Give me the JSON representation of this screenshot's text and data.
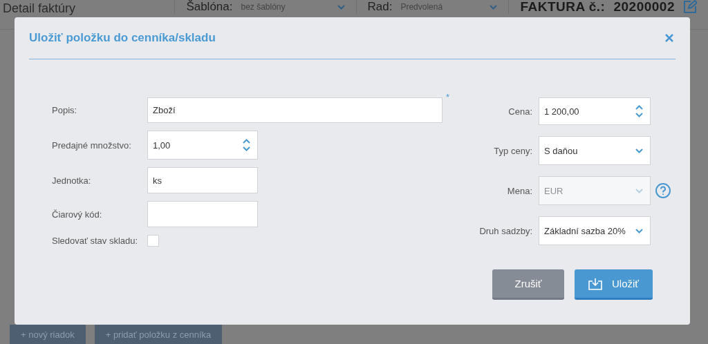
{
  "page": {
    "title": "Detail faktúry",
    "template": {
      "label": "Šablóna:",
      "value": "bez šablóny"
    },
    "series": {
      "label": "Rad:",
      "value": "Predvolená"
    },
    "invoice": {
      "label": "FAKTURA č.:",
      "number": "20200002"
    },
    "actions": [
      "+ nový riadok",
      "+ pridať položku z cenníka"
    ]
  },
  "dialog": {
    "title": "Uložiť položku do cenníka/skladu",
    "left_fields": [
      {
        "kind": "wide-text",
        "label": "Popis:",
        "value": "Zboží",
        "required_mark": "*"
      },
      {
        "kind": "number",
        "label": "Predajné množstvo:",
        "value": "1,00"
      },
      {
        "kind": "text",
        "label": "Jednotka:",
        "value": "ks"
      },
      {
        "kind": "text",
        "label": "Čiarový kód:"
      },
      {
        "kind": "checkbox",
        "label": "Sledovať stav skladu:",
        "checked": false
      }
    ],
    "right_fields": [
      {
        "kind": "number",
        "label": "Cena:",
        "value": "1 200,00"
      },
      {
        "kind": "select",
        "label": "Typ ceny:",
        "value": "S daňou",
        "disabled": false
      },
      {
        "kind": "select",
        "label": "Mena:",
        "value": "EUR",
        "disabled": true,
        "help": true
      },
      {
        "kind": "select",
        "label": "Druh sadzby:",
        "value": "Základní sazba 20%",
        "disabled": false
      }
    ],
    "buttons": [
      {
        "kind": "cancel",
        "label": "Zrušiť"
      },
      {
        "kind": "save",
        "label": "Uložiť"
      }
    ]
  }
}
